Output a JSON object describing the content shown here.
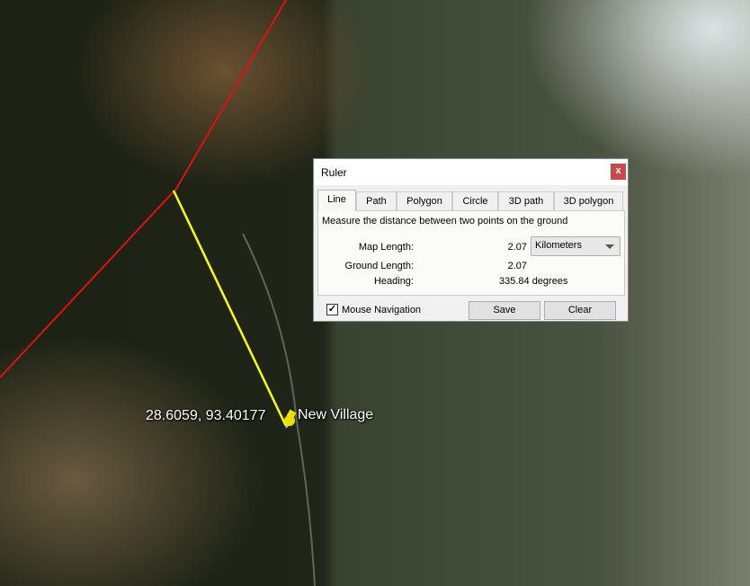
{
  "map": {
    "placemark": {
      "coords": "28.6059, 93.40177",
      "name": "New Village",
      "icon": "pushpin-icon",
      "color": "#e8e000"
    },
    "ruler_line_color": "#ffff00",
    "boundary_line_color": "#e01010"
  },
  "ruler": {
    "title": "Ruler",
    "close_label": "x",
    "tabs": [
      {
        "label": "Line",
        "active": true
      },
      {
        "label": "Path"
      },
      {
        "label": "Polygon"
      },
      {
        "label": "Circle"
      },
      {
        "label": "3D path"
      },
      {
        "label": "3D polygon"
      }
    ],
    "description": "Measure the distance between two points on the ground",
    "map_length_label": "Map Length:",
    "map_length": "2.07",
    "unit": "Kilometers",
    "ground_length_label": "Ground Length:",
    "ground_length": "2.07",
    "heading_label": "Heading:",
    "heading": "335.84 degrees",
    "mouse_nav_label": "Mouse Navigation",
    "mouse_nav_checked": true,
    "save_label": "Save",
    "clear_label": "Clear"
  }
}
